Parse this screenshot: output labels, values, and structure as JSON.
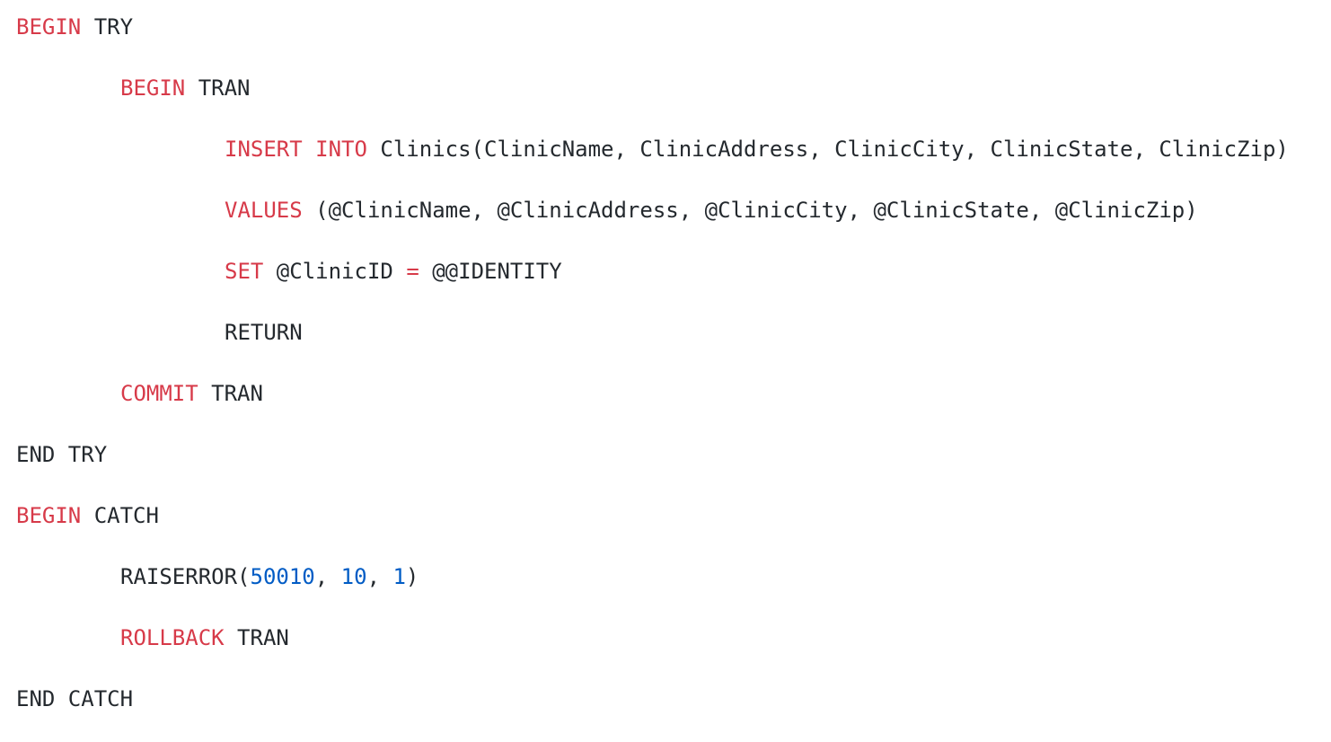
{
  "code": {
    "language": "T-SQL",
    "colors": {
      "keyword": "#d73a49",
      "number": "#005cc5",
      "text": "#24292e",
      "background": "#ffffff"
    },
    "lines": [
      [
        {
          "t": "BEGIN",
          "k": "keyword"
        },
        {
          "t": " TRY",
          "k": "text"
        }
      ],
      [
        {
          "t": "BEGIN",
          "k": "keyword"
        },
        {
          "t": " TRAN",
          "k": "text"
        }
      ],
      [
        {
          "t": "INSERT",
          "k": "keyword"
        },
        {
          "t": " ",
          "k": "text"
        },
        {
          "t": "INTO",
          "k": "keyword"
        },
        {
          "t": " Clinics(ClinicName, ClinicAddress, ClinicCity, ClinicState, ClinicZip)",
          "k": "text"
        }
      ],
      [
        {
          "t": "VALUES",
          "k": "keyword"
        },
        {
          "t": " (@ClinicName, @ClinicAddress, @ClinicCity, @ClinicState, @ClinicZip)",
          "k": "text"
        }
      ],
      [
        {
          "t": "SET",
          "k": "keyword"
        },
        {
          "t": " @ClinicID ",
          "k": "text"
        },
        {
          "t": "=",
          "k": "keyword"
        },
        {
          "t": " @@IDENTITY",
          "k": "text"
        }
      ],
      [
        {
          "t": "RETURN",
          "k": "text"
        }
      ],
      [
        {
          "t": "COMMIT",
          "k": "keyword"
        },
        {
          "t": " TRAN",
          "k": "text"
        }
      ],
      [
        {
          "t": "END TRY",
          "k": "text"
        }
      ],
      [
        {
          "t": "BEGIN",
          "k": "keyword"
        },
        {
          "t": " CATCH",
          "k": "text"
        }
      ],
      [
        {
          "t": "RAISERROR(",
          "k": "text"
        },
        {
          "t": "50010",
          "k": "number"
        },
        {
          "t": ", ",
          "k": "text"
        },
        {
          "t": "10",
          "k": "number"
        },
        {
          "t": ", ",
          "k": "text"
        },
        {
          "t": "1",
          "k": "number"
        },
        {
          "t": ")",
          "k": "text"
        }
      ],
      [
        {
          "t": "ROLLBACK",
          "k": "keyword"
        },
        {
          "t": " TRAN",
          "k": "text"
        }
      ],
      [
        {
          "t": "END CATCH",
          "k": "text"
        }
      ]
    ]
  }
}
